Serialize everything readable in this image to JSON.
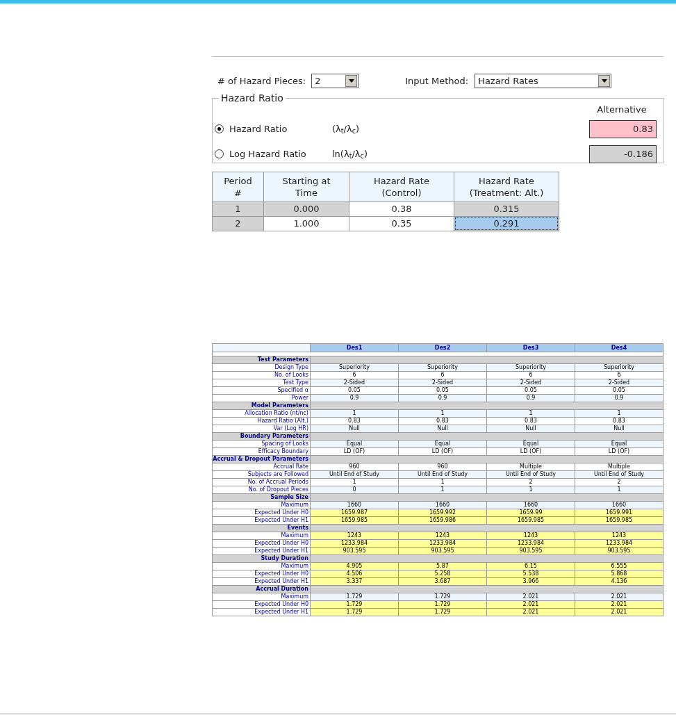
{
  "settings": {
    "pieces_label": "# of Hazard Pieces:",
    "pieces_value": "2",
    "method_label": "Input Method:",
    "method_value": "Hazard Rates"
  },
  "hazard_ratio": {
    "legend": "Hazard Ratio",
    "column_heading": "Alternative",
    "options": [
      {
        "label": "Hazard Ratio",
        "formula": "(λ$_{t}$/λ$_{c}$)",
        "value": "0.83",
        "selected": true
      },
      {
        "label": "Log Hazard Ratio",
        "formula": "ln(λ$_{t}$/λ$_{c}$)",
        "value": "-0.186",
        "selected": false
      }
    ]
  },
  "hazard_table": {
    "columns": [
      "Period #",
      "Starting at Time",
      "Hazard Rate (Control)",
      "Hazard Rate (Treatment: Alt.)"
    ],
    "rows": [
      [
        {
          "text": "1",
          "editable": false,
          "selected": false
        },
        {
          "text": "0.000",
          "editable": false,
          "selected": false
        },
        {
          "text": "0.38",
          "editable": true,
          "selected": false
        },
        {
          "text": "0.315",
          "editable": false,
          "selected": false
        }
      ],
      [
        {
          "text": "2",
          "editable": false,
          "selected": false
        },
        {
          "text": "1.000",
          "editable": true,
          "selected": false
        },
        {
          "text": "0.35",
          "editable": true,
          "selected": false
        },
        {
          "text": "0.291",
          "editable": false,
          "selected": true
        }
      ]
    ]
  },
  "comparison": {
    "columns": [
      "Des1",
      "Des2",
      "Des3",
      "Des4"
    ],
    "rows": [
      {
        "kind": "section",
        "label": "Test Parameters"
      },
      {
        "kind": "row",
        "color": "#eef6fd",
        "label": "Design Type",
        "values": [
          "Superiority",
          "Superiority",
          "Superiority",
          "Superiority"
        ]
      },
      {
        "kind": "row",
        "color": "#ffffff",
        "label": "No. of Looks",
        "values": [
          "6",
          "6",
          "6",
          "6"
        ]
      },
      {
        "kind": "row",
        "color": "#eef6fd",
        "label": "Test Type",
        "values": [
          "2-Sided",
          "2-Sided",
          "2-Sided",
          "2-Sided"
        ]
      },
      {
        "kind": "row",
        "color": "#ffffff",
        "label": "Specified α",
        "values": [
          "0.05",
          "0.05",
          "0.05",
          "0.05"
        ]
      },
      {
        "kind": "row",
        "color": "#eef6fd",
        "label": "Power",
        "values": [
          "0.9",
          "0.9",
          "0.9",
          "0.9"
        ]
      },
      {
        "kind": "section",
        "label": "Model Parameters"
      },
      {
        "kind": "row",
        "color": "#eef6fd",
        "label": "Allocation Ratio (nt/nc)",
        "values": [
          "1",
          "1",
          "1",
          "1"
        ]
      },
      {
        "kind": "row",
        "color": "#ffffff",
        "label": "Hazard Ratio (Alt.)",
        "values": [
          "0.83",
          "0.83",
          "0.83",
          "0.83"
        ]
      },
      {
        "kind": "row",
        "color": "#eef6fd",
        "label": "Var (Log HR)",
        "values": [
          "Null",
          "Null",
          "Null",
          "Null"
        ]
      },
      {
        "kind": "section",
        "label": "Boundary Parameters"
      },
      {
        "kind": "row",
        "color": "#eef6fd",
        "label": "Spacing of Looks",
        "values": [
          "Equal",
          "Equal",
          "Equal",
          "Equal"
        ]
      },
      {
        "kind": "row",
        "color": "#ffffff",
        "label": "Efficacy Boundary",
        "values": [
          "LD (OF)",
          "LD (OF)",
          "LD (OF)",
          "LD (OF)"
        ]
      },
      {
        "kind": "section",
        "label": "Accrual & Dropout Parameters"
      },
      {
        "kind": "row",
        "color": "#ffffff",
        "label": "Accrual Rate",
        "values": [
          "960",
          "960",
          "Multiple",
          "Multiple"
        ]
      },
      {
        "kind": "row",
        "color": "#eef6fd",
        "label": "Subjects are Followed",
        "values": [
          "Until End of Study",
          "Until End of Study",
          "Until End of Study",
          "Until End of Study"
        ]
      },
      {
        "kind": "row",
        "color": "#ffffff",
        "label": "No. of Accrual Periods",
        "values": [
          "1",
          "1",
          "2",
          "2"
        ]
      },
      {
        "kind": "row",
        "color": "#eef6fd",
        "label": "No. of Dropout Pieces",
        "values": [
          "0",
          "1",
          "1",
          "1"
        ]
      },
      {
        "kind": "section",
        "label": "Sample Size"
      },
      {
        "kind": "row",
        "color": "#eef6fd",
        "label": "Maximum",
        "values": [
          "1660",
          "1660",
          "1660",
          "1660"
        ]
      },
      {
        "kind": "row",
        "color": "#ffff99",
        "label": "Expected Under H0",
        "values": [
          "1659.987",
          "1659.992",
          "1659.99",
          "1659.991"
        ]
      },
      {
        "kind": "row",
        "color": "#ffff99",
        "label": "Expected Under H1",
        "values": [
          "1659.985",
          "1659.986",
          "1659.985",
          "1659.985"
        ]
      },
      {
        "kind": "section",
        "label": "Events"
      },
      {
        "kind": "row",
        "color": "#ffff99",
        "label": "Maximum",
        "values": [
          "1243",
          "1243",
          "1243",
          "1243"
        ]
      },
      {
        "kind": "row",
        "color": "#ffff99",
        "label": "Expected Under H0",
        "values": [
          "1233.984",
          "1233.984",
          "1233.984",
          "1233.984"
        ]
      },
      {
        "kind": "row",
        "color": "#ffff99",
        "label": "Expected Under H1",
        "values": [
          "903.595",
          "903.595",
          "903.595",
          "903.595"
        ]
      },
      {
        "kind": "section",
        "label": "Study Duration"
      },
      {
        "kind": "row",
        "color": "#ffff99",
        "label": "Maximum",
        "values": [
          "4.905",
          "5.87",
          "6.15",
          "6.555"
        ]
      },
      {
        "kind": "row",
        "color": "#ffff99",
        "label": "Expected Under H0",
        "values": [
          "4.506",
          "5.258",
          "5.538",
          "5.868"
        ]
      },
      {
        "kind": "row",
        "color": "#ffff99",
        "label": "Expected Under H1",
        "values": [
          "3.337",
          "3.687",
          "3.966",
          "4.136"
        ]
      },
      {
        "kind": "section",
        "label": "Accrual Duration"
      },
      {
        "kind": "row",
        "color": "#eef6fd",
        "label": "Maximum",
        "values": [
          "1.729",
          "1.729",
          "2.021",
          "2.021"
        ]
      },
      {
        "kind": "row",
        "color": "#ffff99",
        "label": "Expected Under H0",
        "values": [
          "1.729",
          "1.729",
          "2.021",
          "2.021"
        ]
      },
      {
        "kind": "row",
        "color": "#ffff99",
        "label": "Expected Under H1",
        "values": [
          "1.729",
          "1.729",
          "2.021",
          "2.021"
        ]
      }
    ]
  }
}
